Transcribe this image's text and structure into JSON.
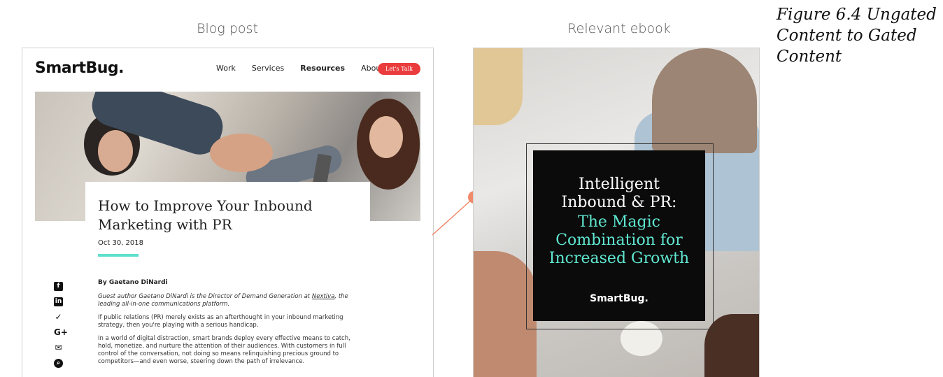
{
  "labels": {
    "blog_post": "Blog post",
    "relevant_ebook": "Relevant ebook"
  },
  "caption": "Figure 6.4 Ungated Content to Gated Content",
  "blog": {
    "logo": "SmartBug.",
    "nav": {
      "work": "Work",
      "services": "Services",
      "resources": "Resources",
      "about": "About"
    },
    "cta": "Let's Talk",
    "title": "How to Improve Your Inbound Marketing with PR",
    "date": "Oct 30, 2018",
    "byline": "By Gaetano DiNardi",
    "author_note_pre": "Guest author Gaetano DiNardi is the Director of Demand Generation at ",
    "author_note_link": "Nextiva",
    "author_note_post": ", the leading all-in-one communications platform.",
    "para1": "If public relations (PR) merely exists as an afterthought in your inbound marketing strategy, then you're playing with a serious handicap.",
    "para2": "In a world of digital distraction, smart brands deploy every effective means to catch, hold, monetize, and nurture the attention of their audiences. With customers in full control of the conversation, not doing so means relinquishing precious ground to competitors—and even worse, steering down the path of irrelevance.",
    "social_icons": [
      "facebook-icon",
      "linkedin-icon",
      "twitter-icon",
      "google-plus-icon",
      "email-icon",
      "search-icon"
    ]
  },
  "ebook": {
    "title_line1": "Intelligent",
    "title_line2": "Inbound & PR:",
    "subtitle_line1": "The Magic",
    "subtitle_line2": "Combination for",
    "subtitle_line3": "Increased Growth",
    "logo": "SmartBug."
  },
  "colors": {
    "accent_red": "#ea3c3c",
    "accent_teal": "#5ee0cd",
    "connector": "#f08a6a"
  }
}
